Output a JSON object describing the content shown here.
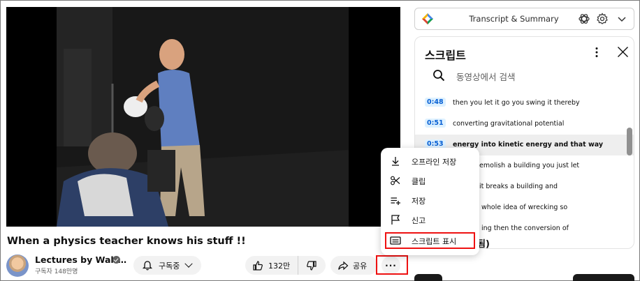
{
  "video": {
    "title": "When a physics teacher knows his stuff !!"
  },
  "channel": {
    "name": "Lectures by Walt…",
    "subscribers": "구독자 148만명"
  },
  "actions": {
    "subscribe_label": "구독중",
    "like_count": "132만",
    "share_label": "공유",
    "more_label": "···"
  },
  "extension": {
    "title": "Transcript & Summary",
    "icons": [
      "tactiq-logo-icon",
      "openai-icon",
      "gear-icon",
      "chevron-down-icon"
    ]
  },
  "transcript": {
    "title": "스크립트",
    "search_placeholder": "동영상에서 검색",
    "segments": [
      {
        "time": "0:48",
        "text": "then you let it go you swing it thereby",
        "active": false
      },
      {
        "time": "0:51",
        "text": "converting gravitational potential",
        "active": false
      },
      {
        "time": "0:53",
        "text": "energy into kinetic energy and that way",
        "active": true
      },
      {
        "time": "",
        "text": "demolish a building you just let",
        "active": false
      },
      {
        "time": "",
        "text": "it breaks a building and",
        "active": false
      },
      {
        "time": "",
        "text": "whole idea of wrecking so",
        "active": false
      },
      {
        "time": "",
        "text": "ing then the conversion of",
        "active": false
      }
    ],
    "bottom_fragment": "됨)"
  },
  "menu": {
    "items": [
      {
        "label": "오프라인 저장",
        "icon": "download-icon"
      },
      {
        "label": "클립",
        "icon": "scissors-icon"
      },
      {
        "label": "저장",
        "icon": "playlist-add-icon"
      },
      {
        "label": "신고",
        "icon": "flag-icon"
      },
      {
        "label": "스크립트 표시",
        "icon": "transcript-icon"
      }
    ]
  },
  "colors": {
    "highlight_box": "#ee1111",
    "timestamp": "#065fd4",
    "pill_bg": "#f2f2f2"
  }
}
